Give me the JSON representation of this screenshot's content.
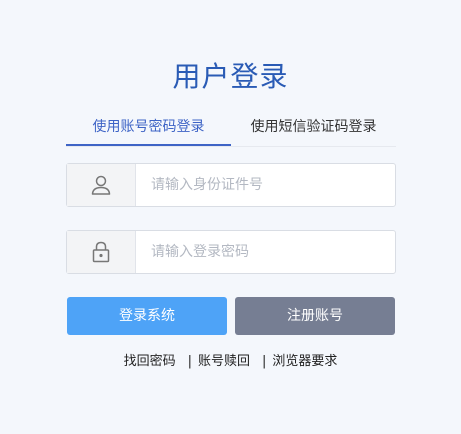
{
  "page": {
    "title": "用户登录"
  },
  "tabs": [
    {
      "label": "使用账号密码登录",
      "active": true
    },
    {
      "label": "使用短信验证码登录",
      "active": false
    }
  ],
  "form": {
    "id_field": {
      "placeholder": "请输入身份证件号",
      "value": "",
      "icon": "user-icon"
    },
    "password_field": {
      "placeholder": "请输入登录密码",
      "value": "",
      "icon": "lock-icon"
    }
  },
  "buttons": {
    "login_label": "登录系统",
    "register_label": "注册账号"
  },
  "links": {
    "find_password": "找回密码",
    "separator": "|",
    "account_recovery": "账号赎回",
    "browser_requirements": "浏览器要求"
  },
  "colors": {
    "title": "#2a5bb5",
    "active_tab": "#3e64c6",
    "login_button": "#4ea3f7",
    "register_button": "#767e93",
    "background": "#f4f7fc"
  }
}
